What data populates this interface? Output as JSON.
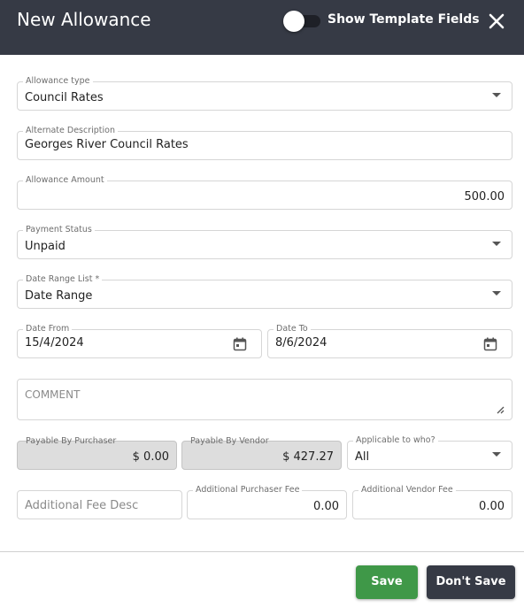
{
  "header": {
    "title": "New Allowance",
    "toggle_label": "Show Template Fields",
    "toggle_on": false,
    "close_icon": "close-icon"
  },
  "form": {
    "allowance_type": {
      "label": "Allowance type",
      "value": "Council Rates"
    },
    "alternate_description": {
      "label": "Alternate Description",
      "value": "Georges River Council Rates"
    },
    "allowance_amount": {
      "label": "Allowance Amount",
      "value": "500.00"
    },
    "payment_status": {
      "label": "Payment Status",
      "value": "Unpaid"
    },
    "date_range_list": {
      "label": "Date Range List *",
      "value": "Date Range"
    },
    "date_from": {
      "label": "Date From",
      "value": "15/4/2024"
    },
    "date_to": {
      "label": "Date To",
      "value": "8/6/2024"
    },
    "comment": {
      "placeholder": "COMMENT"
    },
    "payable_by_purchaser": {
      "label": "Payable By Purchaser",
      "value": "$ 0.00"
    },
    "payable_by_vendor": {
      "label": "Payable By Vendor",
      "value": "$ 427.27"
    },
    "applicable_to": {
      "label": "Applicable to who?",
      "value": "All"
    },
    "additional_fee_desc": {
      "placeholder": "Additional Fee Desc"
    },
    "additional_purchaser_fee": {
      "label": "Additional Purchaser Fee",
      "value": "0.00"
    },
    "additional_vendor_fee": {
      "label": "Additional Vendor Fee",
      "value": "0.00"
    }
  },
  "footer": {
    "save_label": "Save",
    "dont_save_label": "Don't Save"
  },
  "colors": {
    "header_bg": "#363a45",
    "save_green": "#3f9848",
    "disabled_bg": "#dddddd"
  }
}
